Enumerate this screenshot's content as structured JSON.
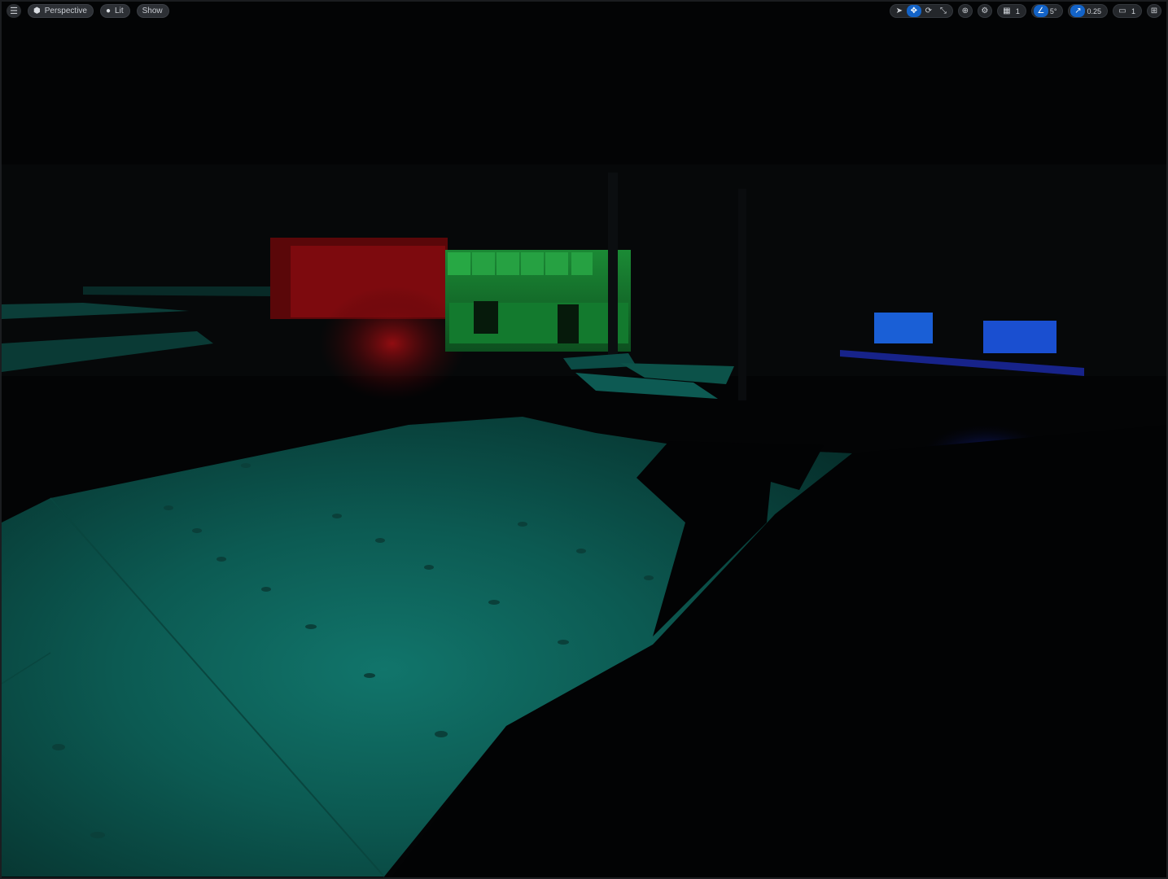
{
  "left_toolbar": {
    "menu_icon": "hamburger-icon",
    "view_mode_label": "Perspective",
    "lighting_label": "Lit",
    "show_label": "Show"
  },
  "right_toolbar": {
    "grid_snap_value": "1",
    "rotation_snap_value": "5°",
    "scale_snap_value": "0.25",
    "camera_speed_value": "1"
  },
  "colors": {
    "accent": "#1363c7",
    "floor_teal": "#0e6b62",
    "red_wall": "#8a0b10",
    "green_kitchen": "#1a9a3b",
    "monitor_blue": "#1a5fd6"
  }
}
